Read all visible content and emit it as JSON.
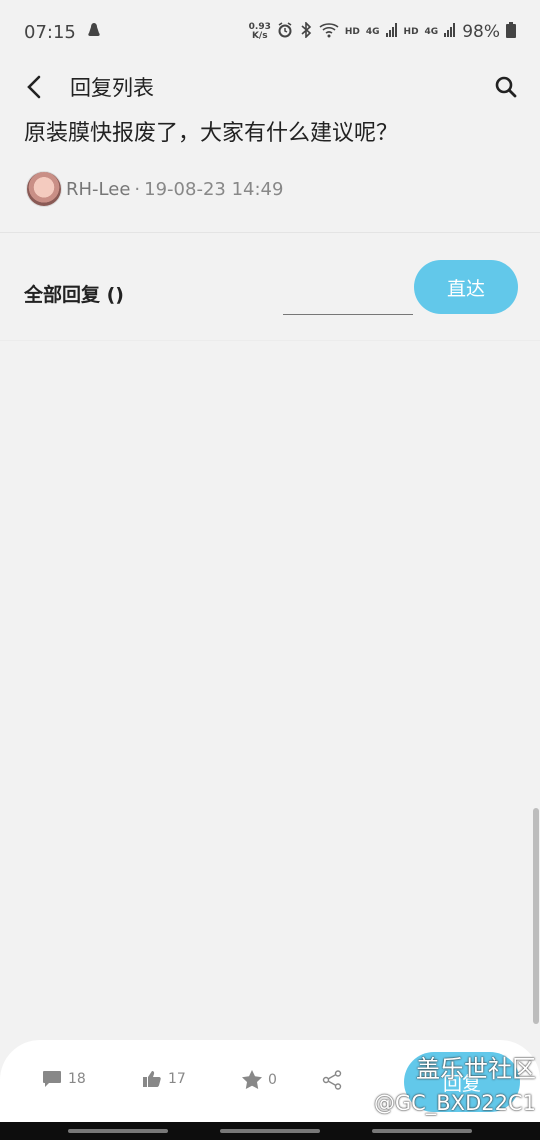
{
  "status_bar": {
    "time": "07:15",
    "speed_value": "0.93",
    "speed_unit": "K/s",
    "hd1": "HD",
    "net1": "4G",
    "hd2": "HD",
    "net2": "4G",
    "battery": "98%"
  },
  "app_bar": {
    "title": "回复列表"
  },
  "post": {
    "title": "原装膜快报废了，大家有什么建议呢？",
    "author": "RH-Lee",
    "separator": "·",
    "date": "19-08-23 14:49"
  },
  "replies": {
    "label": "全部回复 ()",
    "page_input_value": "",
    "go_label": "直达"
  },
  "actions": {
    "comments": "18",
    "likes": "17",
    "favorites": "0",
    "reply_label": "回复"
  },
  "watermark": {
    "line1": "盖乐世社区",
    "line2": "@GC_BXD22C1"
  },
  "colors": {
    "accent": "#62c8ea",
    "background": "#f2f2f2"
  }
}
